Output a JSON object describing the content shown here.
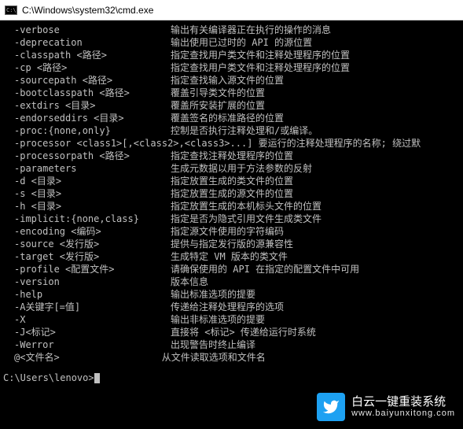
{
  "title": "C:\\Windows\\system32\\cmd.exe",
  "options": [
    {
      "opt": "-verbose",
      "desc": "输出有关编译器正在执行的操作的消息"
    },
    {
      "opt": "-deprecation",
      "desc": "输出使用已过时的 API 的源位置"
    },
    {
      "opt": "-classpath <路径>",
      "desc": "指定查找用户类文件和注释处理程序的位置"
    },
    {
      "opt": "-cp <路径>",
      "desc": "指定查找用户类文件和注释处理程序的位置"
    },
    {
      "opt": "-sourcepath <路径>",
      "desc": "指定查找输入源文件的位置"
    },
    {
      "opt": "-bootclasspath <路径>",
      "desc": "覆盖引导类文件的位置"
    },
    {
      "opt": "-extdirs <目录>",
      "desc": "覆盖所安装扩展的位置"
    },
    {
      "opt": "-endorseddirs <目录>",
      "desc": "覆盖签名的标准路径的位置"
    },
    {
      "opt": "-proc:{none,only}",
      "desc": "控制是否执行注释处理和/或编译。"
    },
    {
      "opt": "-processor <class1>[,<class2>,<class3>...] 要运行的注释处理程序的名称; 绕过默",
      "wide": true
    },
    {
      "opt": "-processorpath <路径>",
      "desc": "指定查找注释处理程序的位置"
    },
    {
      "opt": "-parameters",
      "desc": "生成元数据以用于方法参数的反射"
    },
    {
      "opt": "-d <目录>",
      "desc": "指定放置生成的类文件的位置"
    },
    {
      "opt": "-s <目录>",
      "desc": "指定放置生成的源文件的位置"
    },
    {
      "opt": "-h <目录>",
      "desc": "指定放置生成的本机标头文件的位置"
    },
    {
      "opt": "-implicit:{none,class}",
      "desc": "指定是否为隐式引用文件生成类文件"
    },
    {
      "opt": "-encoding <编码>",
      "desc": "指定源文件使用的字符编码"
    },
    {
      "opt": "-source <发行版>",
      "desc": "提供与指定发行版的源兼容性"
    },
    {
      "opt": "-target <发行版>",
      "desc": "生成特定 VM 版本的类文件"
    },
    {
      "opt": "-profile <配置文件>",
      "desc": "请确保使用的 API 在指定的配置文件中可用"
    },
    {
      "opt": "-version",
      "desc": "版本信息"
    },
    {
      "opt": "-help",
      "desc": "输出标准选项的提要"
    },
    {
      "opt": "-A关键字[=值]",
      "desc": "传递给注释处理程序的选项"
    },
    {
      "opt": "-X",
      "desc": "输出非标准选项的提要"
    },
    {
      "opt": "-J<标记>",
      "desc": "直接将 <标记> 传递给运行时系统"
    },
    {
      "opt": "-Werror",
      "desc": "出现警告时终止编译"
    },
    {
      "opt": "@<文件名>",
      "desc": "从文件读取选项和文件名",
      "descIndent": true
    }
  ],
  "prompt": "C:\\Users\\lenovo>",
  "watermark": {
    "title": "白云一键重装系统",
    "url": "www.baiyunxitong.com"
  }
}
